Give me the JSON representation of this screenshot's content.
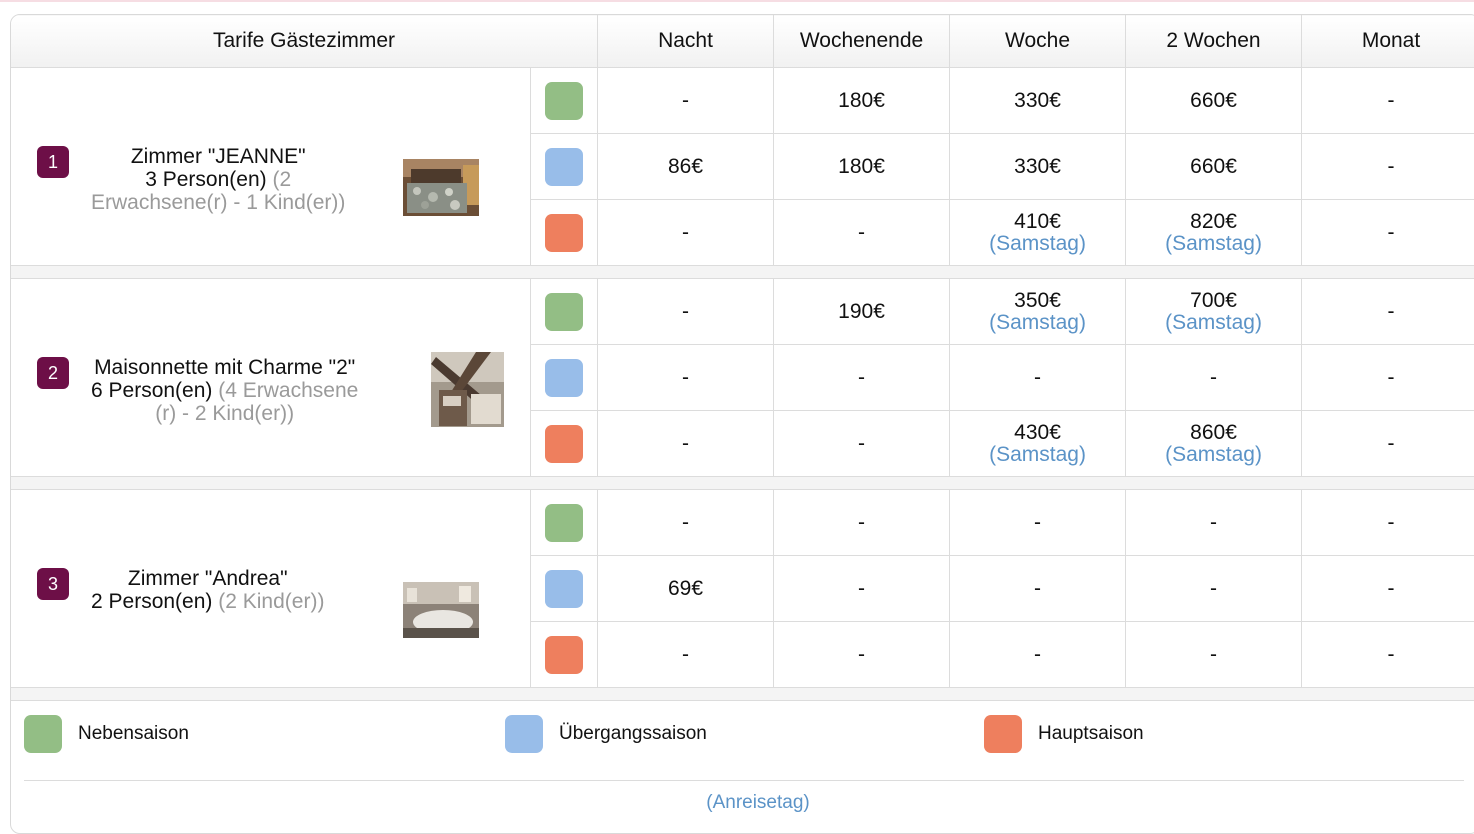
{
  "header": {
    "title": "Tarife Gästezimmer",
    "columns": [
      "Nacht",
      "Wochenende",
      "Woche",
      "2 Wochen",
      "Monat"
    ]
  },
  "colors": {
    "low_season": "#93be85",
    "mid_season": "#98bde9",
    "high_season": "#ee7f5e",
    "badge": "#6d0f47",
    "note": "#5b93c7"
  },
  "rooms": [
    {
      "number": "1",
      "name": "Zimmer \"JEANNE\"",
      "capacity": "3 Person(en)",
      "detail_line1": "(2",
      "detail_line2": "Erwachsene(r) - 1 Kind(er))",
      "photo_icon": "bedroom-photo",
      "rates": [
        {
          "season": "low",
          "prices": [
            {
              "v": "-"
            },
            {
              "v": "180€"
            },
            {
              "v": "330€"
            },
            {
              "v": "660€"
            },
            {
              "v": "-"
            }
          ]
        },
        {
          "season": "mid",
          "prices": [
            {
              "v": "86€"
            },
            {
              "v": "180€"
            },
            {
              "v": "330€"
            },
            {
              "v": "660€"
            },
            {
              "v": "-"
            }
          ]
        },
        {
          "season": "high",
          "prices": [
            {
              "v": "-"
            },
            {
              "v": "-"
            },
            {
              "v": "410€",
              "n": "(Samstag)"
            },
            {
              "v": "820€",
              "n": "(Samstag)"
            },
            {
              "v": "-"
            }
          ]
        }
      ]
    },
    {
      "number": "2",
      "name": "Maisonnette mit Charme \"2\"",
      "capacity": "6 Person(en)",
      "detail_line1": "(4 Erwachsene",
      "detail_line2": "(r) - 2 Kind(er))",
      "photo_icon": "attic-room-photo",
      "rates": [
        {
          "season": "low",
          "prices": [
            {
              "v": "-"
            },
            {
              "v": "190€"
            },
            {
              "v": "350€",
              "n": "(Samstag)"
            },
            {
              "v": "700€",
              "n": "(Samstag)"
            },
            {
              "v": "-"
            }
          ]
        },
        {
          "season": "mid",
          "prices": [
            {
              "v": "-"
            },
            {
              "v": "-"
            },
            {
              "v": "-"
            },
            {
              "v": "-"
            },
            {
              "v": "-"
            }
          ]
        },
        {
          "season": "high",
          "prices": [
            {
              "v": "-"
            },
            {
              "v": "-"
            },
            {
              "v": "430€",
              "n": "(Samstag)"
            },
            {
              "v": "860€",
              "n": "(Samstag)"
            },
            {
              "v": "-"
            }
          ]
        }
      ]
    },
    {
      "number": "3",
      "name": "Zimmer \"Andrea\"",
      "capacity": "2 Person(en)",
      "detail_line1": "(2 Kind(er))",
      "detail_line2": "",
      "photo_icon": "bedroom-photo",
      "rates": [
        {
          "season": "low",
          "prices": [
            {
              "v": "-"
            },
            {
              "v": "-"
            },
            {
              "v": "-"
            },
            {
              "v": "-"
            },
            {
              "v": "-"
            }
          ]
        },
        {
          "season": "mid",
          "prices": [
            {
              "v": "69€"
            },
            {
              "v": "-"
            },
            {
              "v": "-"
            },
            {
              "v": "-"
            },
            {
              "v": "-"
            }
          ]
        },
        {
          "season": "high",
          "prices": [
            {
              "v": "-"
            },
            {
              "v": "-"
            },
            {
              "v": "-"
            },
            {
              "v": "-"
            },
            {
              "v": "-"
            }
          ]
        }
      ]
    }
  ],
  "legend": {
    "low": "Nebensaison",
    "mid": "Übergangssaison",
    "high": "Hauptsaison",
    "note": "(Anreisetag)"
  }
}
